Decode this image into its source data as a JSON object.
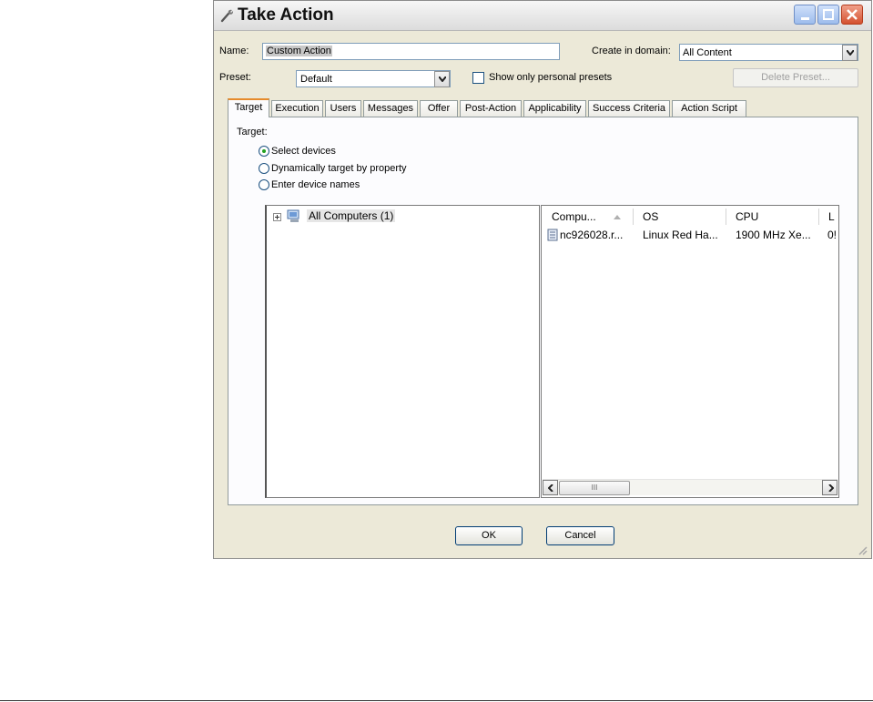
{
  "window": {
    "title": "Take Action"
  },
  "form": {
    "name_label": "Name:",
    "name_value": "Custom Action",
    "domain_label": "Create in domain:",
    "domain_value": "All Content",
    "preset_label": "Preset:",
    "preset_value": "Default",
    "personal_presets_label": "Show only personal presets",
    "personal_presets_checked": false,
    "delete_preset_label": "Delete Preset..."
  },
  "tabs": [
    {
      "label": "Target",
      "active": true
    },
    {
      "label": "Execution",
      "active": false
    },
    {
      "label": "Users",
      "active": false
    },
    {
      "label": "Messages",
      "active": false
    },
    {
      "label": "Offer",
      "active": false
    },
    {
      "label": "Post-Action",
      "active": false
    },
    {
      "label": "Applicability",
      "active": false
    },
    {
      "label": "Success Criteria",
      "active": false
    },
    {
      "label": "Action Script",
      "active": false
    }
  ],
  "target": {
    "heading": "Target:",
    "options": [
      {
        "label": "Select devices",
        "selected": true
      },
      {
        "label": "Dynamically target by property",
        "selected": false
      },
      {
        "label": "Enter device names",
        "selected": false
      }
    ],
    "tree": {
      "root_label": "All Computers (1)"
    },
    "list": {
      "columns": [
        "Compu...",
        "OS",
        "CPU",
        "L"
      ],
      "rows": [
        {
          "computer": "nc926028.r...",
          "os": "Linux Red Ha...",
          "cpu": "1900 MHz Xe...",
          "last": "0!"
        }
      ],
      "scroll_thumb_glyph": "III"
    }
  },
  "buttons": {
    "ok": "OK",
    "cancel": "Cancel"
  },
  "colors": {
    "active_tab_accent": "#e68b2c",
    "close_button": "#d4502f",
    "radio_selected": "#21a121"
  }
}
